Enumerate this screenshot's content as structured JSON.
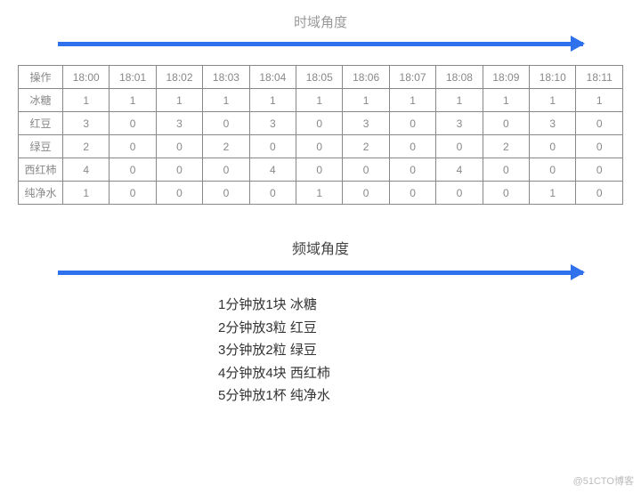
{
  "top_title": "时域角度",
  "table": {
    "headers": [
      "操作",
      "18:00",
      "18:01",
      "18:02",
      "18:03",
      "18:04",
      "18:05",
      "18:06",
      "18:07",
      "18:08",
      "18:09",
      "18:10",
      "18:11"
    ],
    "rows": [
      {
        "label": "冰糖",
        "cells": [
          "1",
          "1",
          "1",
          "1",
          "1",
          "1",
          "1",
          "1",
          "1",
          "1",
          "1",
          "1"
        ]
      },
      {
        "label": "红豆",
        "cells": [
          "3",
          "0",
          "3",
          "0",
          "3",
          "0",
          "3",
          "0",
          "3",
          "0",
          "3",
          "0"
        ]
      },
      {
        "label": "绿豆",
        "cells": [
          "2",
          "0",
          "0",
          "2",
          "0",
          "0",
          "2",
          "0",
          "0",
          "2",
          "0",
          "0"
        ]
      },
      {
        "label": "西红柿",
        "cells": [
          "4",
          "0",
          "0",
          "0",
          "4",
          "0",
          "0",
          "0",
          "4",
          "0",
          "0",
          "0"
        ]
      },
      {
        "label": "纯净水",
        "cells": [
          "1",
          "0",
          "0",
          "0",
          "0",
          "1",
          "0",
          "0",
          "0",
          "0",
          "1",
          "0"
        ]
      }
    ]
  },
  "mid_title": "频域角度",
  "freq_items": [
    "1分钟放1块 冰糖",
    "2分钟放3粒 红豆",
    "3分钟放2粒 绿豆",
    "4分钟放4块 西红柿",
    "5分钟放1杯 纯净水"
  ],
  "credit": "@51CTO博客"
}
